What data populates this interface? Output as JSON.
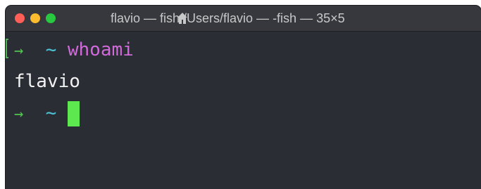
{
  "window": {
    "title": "flavio — fish /Users/flavio — -fish — 35×5"
  },
  "icons": {
    "close": "close-button",
    "minimize": "minimize-button",
    "zoom": "zoom-button",
    "title_icon": "home-icon"
  },
  "terminal": {
    "prompt_arrow": "→",
    "prompt_cwd": "~",
    "command": "whoami",
    "output": "flavio"
  },
  "colors": {
    "background": "#2b2d35",
    "titlebar": "#37383d",
    "prompt_arrow": "#4dc64d",
    "cwd": "#4ec3d7",
    "command": "#d06ad9",
    "output": "#f2f2f2",
    "cursor": "#5ee850"
  }
}
